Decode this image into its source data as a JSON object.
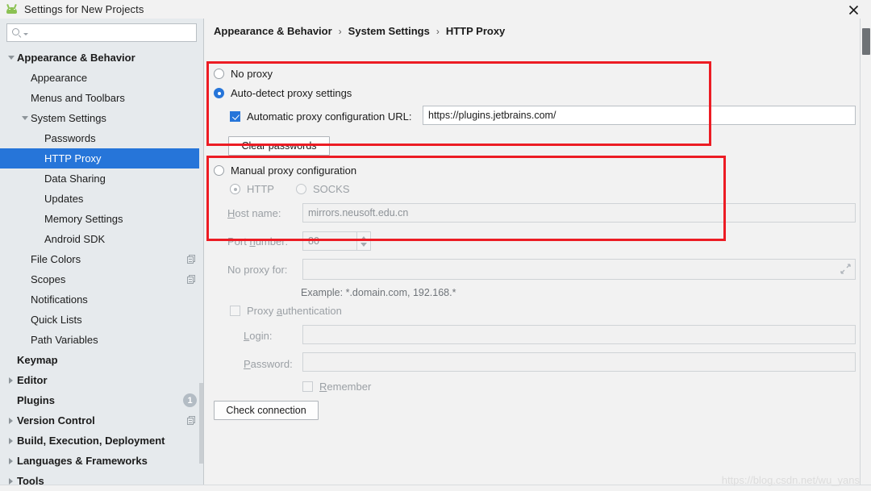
{
  "window": {
    "title": "Settings for New Projects",
    "app_icon": "android-robot-icon",
    "close_label": "×"
  },
  "sidebar": {
    "search": {
      "placeholder": "",
      "value": "",
      "icon": "search-icon"
    },
    "items": [
      {
        "label": "Appearance & Behavior",
        "indent": 0,
        "twisty": "down",
        "bold": true,
        "selected": false,
        "right": ""
      },
      {
        "label": "Appearance",
        "indent": 1,
        "twisty": "none",
        "bold": false,
        "selected": false,
        "right": ""
      },
      {
        "label": "Menus and Toolbars",
        "indent": 1,
        "twisty": "none",
        "bold": false,
        "selected": false,
        "right": ""
      },
      {
        "label": "System Settings",
        "indent": 1,
        "twisty": "down",
        "bold": false,
        "selected": false,
        "right": ""
      },
      {
        "label": "Passwords",
        "indent": 2,
        "twisty": "none",
        "bold": false,
        "selected": false,
        "right": ""
      },
      {
        "label": "HTTP Proxy",
        "indent": 2,
        "twisty": "none",
        "bold": false,
        "selected": true,
        "right": ""
      },
      {
        "label": "Data Sharing",
        "indent": 2,
        "twisty": "none",
        "bold": false,
        "selected": false,
        "right": ""
      },
      {
        "label": "Updates",
        "indent": 2,
        "twisty": "none",
        "bold": false,
        "selected": false,
        "right": ""
      },
      {
        "label": "Memory Settings",
        "indent": 2,
        "twisty": "none",
        "bold": false,
        "selected": false,
        "right": ""
      },
      {
        "label": "Android SDK",
        "indent": 2,
        "twisty": "none",
        "bold": false,
        "selected": false,
        "right": ""
      },
      {
        "label": "File Colors",
        "indent": 1,
        "twisty": "none",
        "bold": false,
        "selected": false,
        "right": "copy"
      },
      {
        "label": "Scopes",
        "indent": 1,
        "twisty": "none",
        "bold": false,
        "selected": false,
        "right": "copy"
      },
      {
        "label": "Notifications",
        "indent": 1,
        "twisty": "none",
        "bold": false,
        "selected": false,
        "right": ""
      },
      {
        "label": "Quick Lists",
        "indent": 1,
        "twisty": "none",
        "bold": false,
        "selected": false,
        "right": ""
      },
      {
        "label": "Path Variables",
        "indent": 1,
        "twisty": "none",
        "bold": false,
        "selected": false,
        "right": ""
      },
      {
        "label": "Keymap",
        "indent": 0,
        "twisty": "none",
        "bold": true,
        "selected": false,
        "right": ""
      },
      {
        "label": "Editor",
        "indent": 0,
        "twisty": "right",
        "bold": true,
        "selected": false,
        "right": ""
      },
      {
        "label": "Plugins",
        "indent": 0,
        "twisty": "none",
        "bold": true,
        "selected": false,
        "right": "badge",
        "badge": "1"
      },
      {
        "label": "Version Control",
        "indent": 0,
        "twisty": "right",
        "bold": true,
        "selected": false,
        "right": "copy"
      },
      {
        "label": "Build, Execution, Deployment",
        "indent": 0,
        "twisty": "right",
        "bold": true,
        "selected": false,
        "right": ""
      },
      {
        "label": "Languages & Frameworks",
        "indent": 0,
        "twisty": "right",
        "bold": true,
        "selected": false,
        "right": ""
      },
      {
        "label": "Tools",
        "indent": 0,
        "twisty": "right",
        "bold": true,
        "selected": false,
        "right": ""
      }
    ]
  },
  "breadcrumb": {
    "part1": "Appearance & Behavior",
    "sep1": "›",
    "part2": "System Settings",
    "sep2": "›",
    "part3": "HTTP Proxy"
  },
  "proxy": {
    "no_proxy_label": "No proxy",
    "auto_detect_label": "Auto-detect proxy settings",
    "auto_config_url_label": "Automatic proxy configuration URL:",
    "auto_config_url_value": "https://plugins.jetbrains.com/",
    "clear_passwords_label": "Clear passwords",
    "manual_label": "Manual proxy configuration",
    "http_label": "HTTP",
    "socks_label": "SOCKS",
    "host_name_label": "Host name:",
    "host_name_value": "mirrors.neusoft.edu.cn",
    "port_number_label": "Port number:",
    "port_number_value": "80",
    "no_proxy_for_label": "No proxy for:",
    "no_proxy_for_value": "",
    "example_text": "Example: *.domain.com, 192.168.*",
    "proxy_auth_label": "Proxy authentication",
    "login_label": "Login:",
    "login_value": "",
    "password_label": "Password:",
    "password_value": "",
    "remember_label": "Remember",
    "check_connection_label": "Check connection"
  },
  "watermark": "https://blog.csdn.net/wu_yans",
  "colors": {
    "accent": "#2675d9",
    "annotation": "#ec1c24",
    "sidebar_bg": "#e6eaed",
    "panel_bg": "#f2f2f2"
  }
}
